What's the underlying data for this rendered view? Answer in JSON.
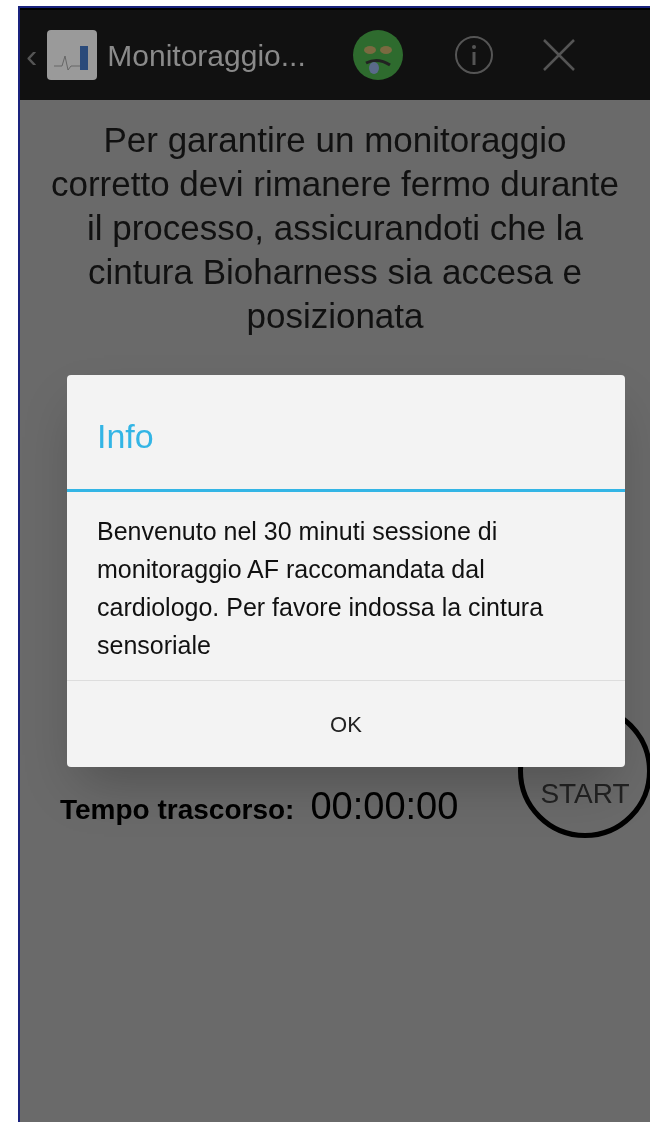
{
  "action_bar": {
    "back": "‹",
    "title": "Monitoraggio..."
  },
  "intro": "Per garantire un monitoraggio corretto devi rimanere fermo durante il processo, assicurandoti che la cintura Bioharness sia accesa e posizionata",
  "elapsed": {
    "label": "Tempo trascorso:",
    "value": "00:00:00"
  },
  "start_button": "START",
  "dialog": {
    "title": "Info",
    "message": "Benvenuto nel 30 minuti  sessione di monitoraggio AF raccomandata dal cardiologo. Per favore indossa la cintura sensoriale",
    "buttons": [
      "OK"
    ]
  }
}
